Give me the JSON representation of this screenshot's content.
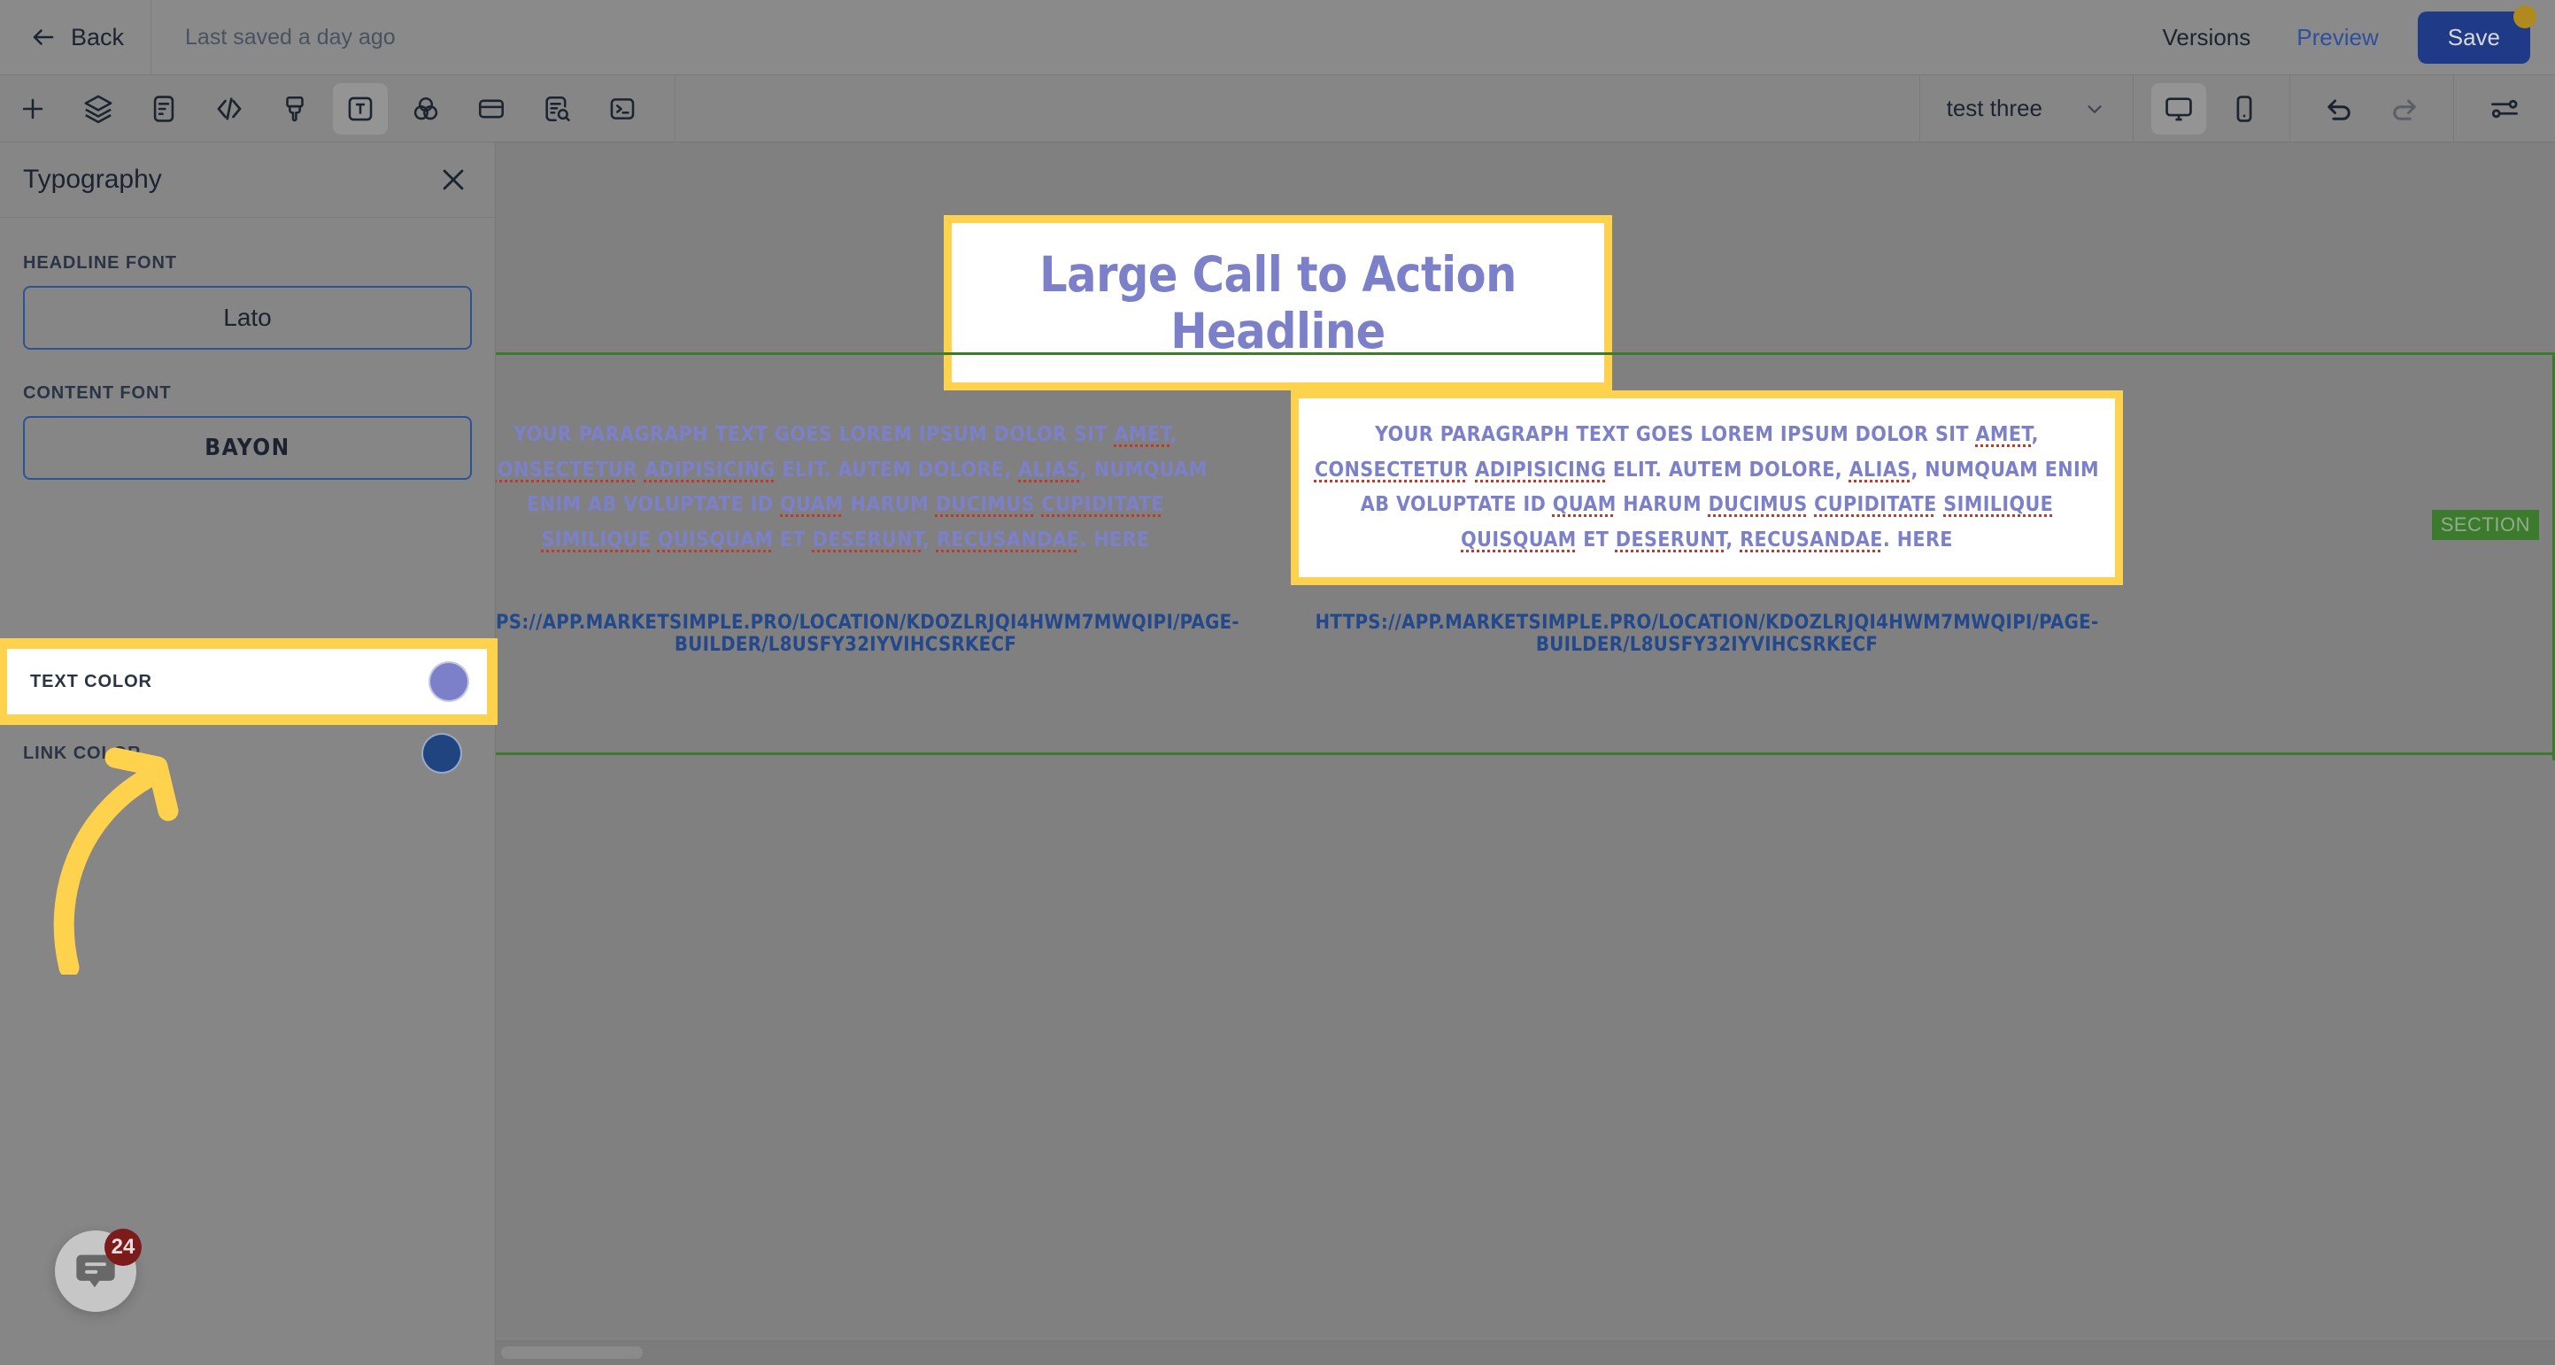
{
  "header": {
    "back_label": "Back",
    "saved_status": "Last saved a day ago",
    "versions_label": "Versions",
    "preview_label": "Preview",
    "save_label": "Save",
    "save_indicator": "unsaved-changes-dot"
  },
  "toolbar": {
    "items": [
      {
        "name": "add-element-icon",
        "label": "+"
      },
      {
        "name": "layers-icon",
        "label": "Layers"
      },
      {
        "name": "document-icon",
        "label": "Page"
      },
      {
        "name": "code-icon",
        "label": "Code"
      },
      {
        "name": "brush-icon",
        "label": "Styles"
      },
      {
        "name": "text-icon",
        "label": "Typography",
        "active": true
      },
      {
        "name": "color-palette-icon",
        "label": "Colors"
      },
      {
        "name": "card-icon",
        "label": "Sections"
      },
      {
        "name": "seo-search-icon",
        "label": "SEO"
      },
      {
        "name": "terminal-icon",
        "label": "Console"
      }
    ],
    "page_select_value": "test three",
    "viewport_desktop": "desktop-icon",
    "viewport_mobile": "mobile-icon",
    "undo": "undo-icon",
    "redo": "redo-icon",
    "settings": "sliders-icon"
  },
  "panel": {
    "title": "Typography",
    "close": "close-icon",
    "headline_font_label": "HEADLINE FONT",
    "headline_font_value": "Lato",
    "content_font_label": "CONTENT FONT",
    "content_font_value": "BAYON",
    "text_color_label": "TEXT COLOR",
    "text_color_value": "#7b80c8",
    "link_color_label": "LINK COLOR",
    "link_color_value": "#1f4480",
    "highlight_color": "#ffd24d",
    "annotation": "curved-arrow-pointing-to-text-color"
  },
  "canvas": {
    "headline": "Large Call to Action Headline",
    "section_badge": "SECTION",
    "section_border_color": "#3c7a2e",
    "paragraph_line1_a": "YOUR PARAGRAPH TEXT GOES LOREM IPSUM DOLOR SIT ",
    "paragraph_line1_b": "AMET",
    "paragraph_line1_c": ", ",
    "paragraph_line1_d": "CONSECTETUR",
    "paragraph_line1_e": " ",
    "paragraph_line1_f": "ADIPISICING",
    "paragraph_line1_g": " ELIT. AUTEM DOLORE,",
    "paragraph_line2_a": "ALIAS",
    "paragraph_line2_b": ", NUMQUAM ENIM AB VOLUPTATE ID ",
    "paragraph_line2_c": "QUAM",
    "paragraph_line2_d": " HARUM ",
    "paragraph_line2_e": "DUCIMUS",
    "paragraph_line2_f": " ",
    "paragraph_line2_g": "CUPIDITATE",
    "paragraph_line2_h": " ",
    "paragraph_line2_i": "SIMILIQUE",
    "paragraph_line2_j": " ",
    "paragraph_line2_k": "QUISQUAM",
    "paragraph_line2_l": " ET ",
    "paragraph_line2_m": "DESERUNT",
    "paragraph_line2_n": ",",
    "paragraph_line3_a": "RECUSANDAE",
    "paragraph_line3_b": ". HERE",
    "url": "HTTPS://APP.MARKETSIMPLE.PRO/LOCATION/KDOZLRJQI4HWM7MWQIPI/PAGE-BUILDER/L8USFY32IYVIHCSRKECF",
    "text_color": "#7b80c8",
    "link_color": "#23488c",
    "highlight_color": "#ffd24d"
  },
  "chat": {
    "icon": "chat-bubble-icon",
    "unread_count": "24"
  }
}
